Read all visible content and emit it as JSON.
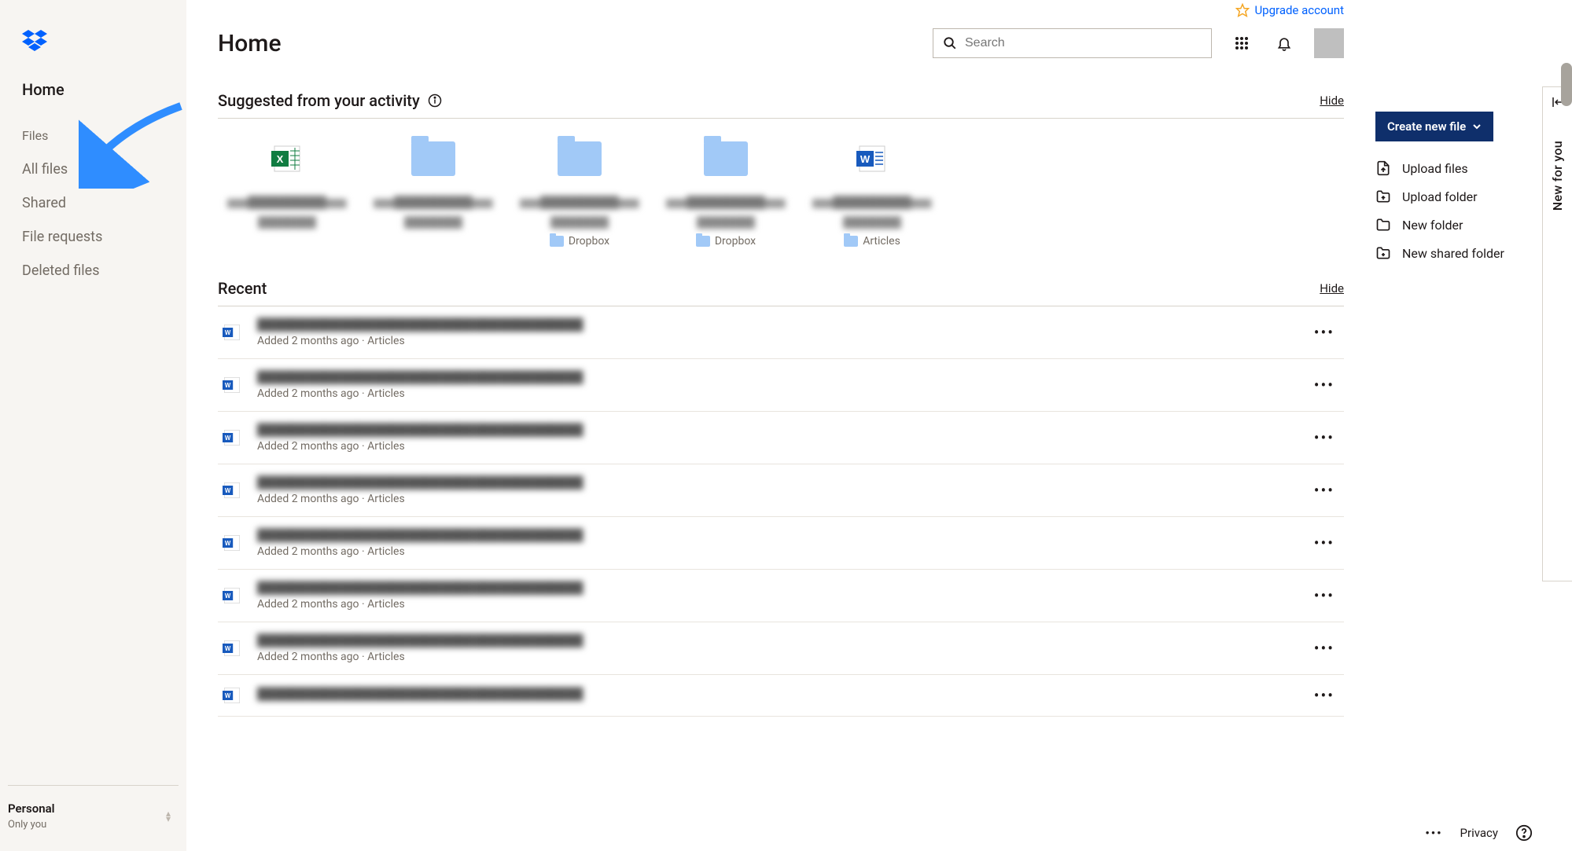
{
  "header": {
    "upgrade_label": "Upgrade account",
    "title": "Home",
    "search_placeholder": "Search"
  },
  "sidebar": {
    "home_label": "Home",
    "files_section_label": "Files",
    "items": [
      {
        "label": "All files"
      },
      {
        "label": "Shared"
      },
      {
        "label": "File requests"
      },
      {
        "label": "Deleted files"
      }
    ],
    "footer": {
      "name": "Personal",
      "sub": "Only you"
    }
  },
  "suggested": {
    "title": "Suggested from your activity",
    "hide_label": "Hide",
    "cards": [
      {
        "type": "excel",
        "location": null
      },
      {
        "type": "folder",
        "location": null
      },
      {
        "type": "folder",
        "location": "Dropbox"
      },
      {
        "type": "folder",
        "location": "Dropbox"
      },
      {
        "type": "word",
        "location": "Articles"
      }
    ]
  },
  "recent": {
    "title": "Recent",
    "hide_label": "Hide",
    "rows": [
      {
        "meta": "Added 2 months ago · Articles"
      },
      {
        "meta": "Added 2 months ago · Articles"
      },
      {
        "meta": "Added 2 months ago · Articles"
      },
      {
        "meta": "Added 2 months ago · Articles"
      },
      {
        "meta": "Added 2 months ago · Articles"
      },
      {
        "meta": "Added 2 months ago · Articles"
      },
      {
        "meta": "Added 2 months ago · Articles"
      },
      {
        "meta": ""
      }
    ]
  },
  "rail": {
    "create_label": "Create new file",
    "items": [
      {
        "label": "Upload files"
      },
      {
        "label": "Upload folder"
      },
      {
        "label": "New folder"
      },
      {
        "label": "New shared folder"
      }
    ]
  },
  "new_for_you": "New for you",
  "bottom": {
    "privacy": "Privacy"
  }
}
